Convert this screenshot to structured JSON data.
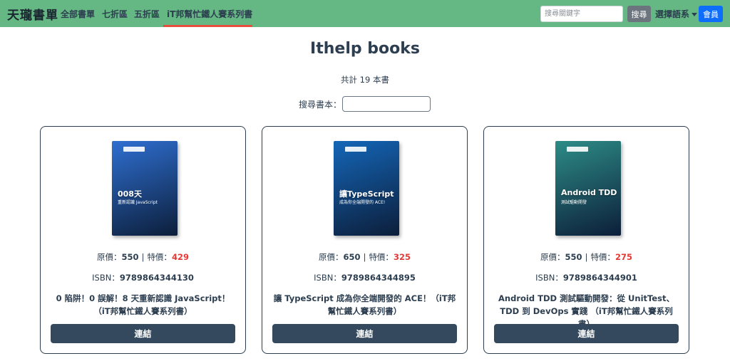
{
  "nav": {
    "brand": "天瓏書單",
    "links": [
      "全部書單",
      "七折區",
      "五折區",
      "iT邦幫忙鐵人賽系列書"
    ],
    "search_placeholder": "搜尋關鍵字",
    "search_button": "搜尋",
    "language": "選擇語系",
    "member": "會員"
  },
  "page": {
    "title": "Ithelp books",
    "count_text": "共計 19 本書",
    "filter_label": "搜尋書本：",
    "filter_value": ""
  },
  "labels": {
    "original_price": "原價：",
    "special_price": "特價：",
    "separator": "|",
    "isbn": "ISBN：",
    "link_button": "連結"
  },
  "books": [
    {
      "original_price": "550",
      "special_price": "429",
      "isbn": "9789864344130",
      "title": "0 陷阱！0 誤解！8 天重新認識 JavaScript！（iT邦幫忙鐵人賽系列書）",
      "cover_headline": "008天",
      "cover_subtitle": "重新認識 JavaScript",
      "cover_color": "#2f6fd1"
    },
    {
      "original_price": "650",
      "special_price": "325",
      "isbn": "9789864344895",
      "title": "讓 TypeScript 成為你全端開發的 ACE！（iT邦幫忙鐵人賽系列書）",
      "cover_headline": "讓TypeScript",
      "cover_subtitle": "成為你全端開發的 ACE!",
      "cover_color": "#1466b8"
    },
    {
      "original_price": "550",
      "special_price": "275",
      "isbn": "9789864344901",
      "title": "Android TDD 測試驅動開發：從 UnitTest、TDD 到 DevOps 實踐 （iT邦幫忙鐵人賽系列書）",
      "cover_headline": "Android TDD",
      "cover_subtitle": "測試驅動開發",
      "cover_color": "#2d8c86"
    }
  ]
}
